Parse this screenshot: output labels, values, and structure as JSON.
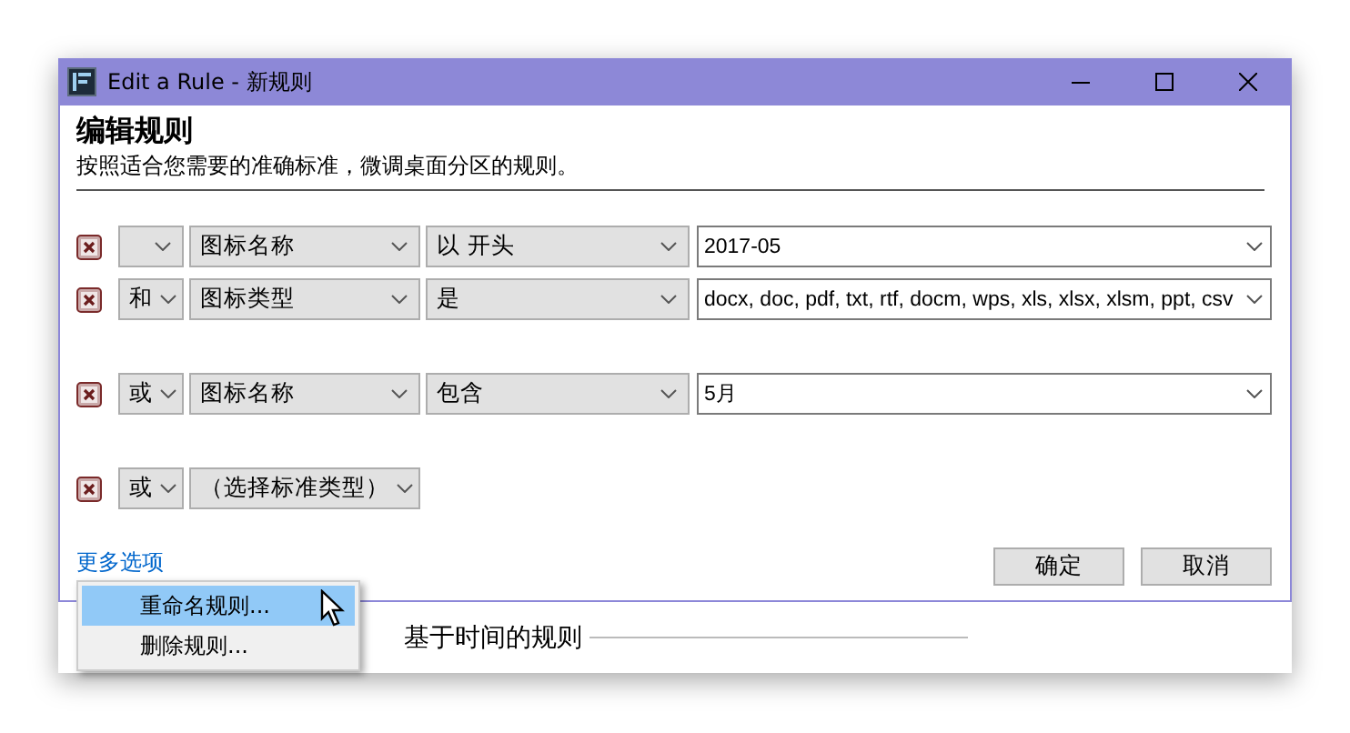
{
  "window": {
    "title": "Edit a Rule - 新规则"
  },
  "heading": "编辑规则",
  "description": "按照适合您需要的准确标准，微调桌面分区的规则。",
  "rule_groups": [
    {
      "rules": [
        {
          "kind": "condition",
          "field": "图标名称",
          "operator": "以 开头",
          "value": "2017-05"
        },
        {
          "kind": "condition",
          "conjunction": "和",
          "field": "图标类型",
          "operator": "是",
          "value": "docx, doc, pdf, txt, rtf, docm, wps, xls, xlsx, xlsm, ppt, csv"
        }
      ]
    },
    {
      "rules": [
        {
          "kind": "condition",
          "conjunction": "或",
          "field": "图标名称",
          "operator": "包含",
          "value": "5月"
        }
      ]
    },
    {
      "rules": [
        {
          "kind": "type-picker",
          "conjunction": "或",
          "field": "（选择标准类型）"
        }
      ]
    }
  ],
  "more_options_link": "更多选项",
  "buttons": [
    "确定",
    "取消"
  ],
  "context_menu": [
    {
      "label": "重命名规则...",
      "selected": true
    },
    {
      "label": "删除规则...",
      "selected": false
    }
  ],
  "background_section": "基于时间的规则"
}
